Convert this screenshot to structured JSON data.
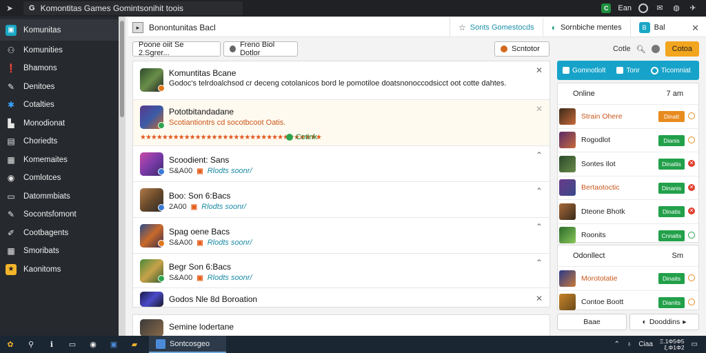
{
  "browser": {
    "url_text": "Komontitas Games Gomintsonihit toois",
    "url_prefix": "G",
    "right_badge": "C",
    "right_label": "Ean"
  },
  "sidebar": {
    "items": [
      {
        "label": "Komunitas",
        "icon": "app-icon",
        "glyph": "▣"
      },
      {
        "label": "Komunities",
        "icon": "users-icon",
        "glyph": "⚇"
      },
      {
        "label": "Bhamons",
        "icon": "info-icon",
        "glyph": "❗"
      },
      {
        "label": "Denitoes",
        "icon": "wrench-icon",
        "glyph": "✎"
      },
      {
        "label": "Cotalties",
        "icon": "tools-icon",
        "glyph": "✱"
      },
      {
        "label": "Monodionat",
        "icon": "chart-icon",
        "glyph": "▙"
      },
      {
        "label": "Choriedts",
        "icon": "chat-icon",
        "glyph": "▤"
      },
      {
        "label": "Komemaites",
        "icon": "grid-icon",
        "glyph": "▦"
      },
      {
        "label": "Comlotces",
        "icon": "circle-icon",
        "glyph": "◉"
      },
      {
        "label": "Datommbiats",
        "icon": "folder-icon",
        "glyph": "▭"
      },
      {
        "label": "Socontsfomont",
        "icon": "tag-icon",
        "glyph": "✎"
      },
      {
        "label": "Cootbagents",
        "icon": "pencil-icon",
        "glyph": "✐"
      },
      {
        "label": "Smoribats",
        "icon": "grid-small-icon",
        "glyph": "▦"
      },
      {
        "label": "Kaonitoms",
        "icon": "star-folder-icon",
        "glyph": "★"
      }
    ]
  },
  "header": {
    "title": "Bonontunitas Bacl",
    "tab_star_label": "Sonts Gomestocds",
    "tab_teal_label": "Sornbiche mentes",
    "tab_box_label": "Bal",
    "tab_box_icon_text": "B"
  },
  "filters": {
    "pill1": "Poone oiit Se 2.Sgrer...",
    "pill2": "Freno Biol Dotlor",
    "pill3": "Scntotor",
    "right_text": "Cotle",
    "orange_btn": "Cotoa"
  },
  "feed": {
    "items": [
      {
        "title": "Komuntitas Bcane",
        "text": "Godoc's telrdoalchsod cr deceng cotolanicos bord le pomotiloe doatsnonoccodsicct oot cotte dahtes."
      },
      {
        "title": "Pototbitandadane",
        "text": "Scotiantiontrs cd socotbcoot Oatis.",
        "stars": "★★★★★★★★★★★★★★★★★★★★★★★★★★★★★★★★★",
        "link": "Cotink"
      },
      {
        "title": "Scoodient: Sans",
        "meta_num": "S&A00",
        "meta_link": "Rlodts soonr/"
      },
      {
        "title": "Boo: Son 6:Bacs",
        "meta_num": "2A00",
        "meta_link": "Rlodts soonr/"
      },
      {
        "title": "Spag oene Bacs",
        "meta_num": "S&A00",
        "meta_link": "Rlodts soonr/"
      },
      {
        "title": "Begr Son 6:Bacs",
        "meta_num": "S&A00",
        "meta_link": "Rlodts soonr/"
      },
      {
        "title": "Godos Nle 8d Boroation"
      }
    ],
    "bottom_title": "Semine lodertane"
  },
  "rpanel": {
    "top": {
      "btn1": "Gomnotlolt",
      "btn2": "Tonr",
      "btn3": "Ticomniat"
    },
    "online": {
      "title": "Online",
      "right": "7 am",
      "rows": [
        {
          "name": "Strain Ohere",
          "btn": "Dinatt",
          "btn_style": "orange",
          "name_style": "orange",
          "x_style": "orange"
        },
        {
          "name": "Rogodlot",
          "btn": "Dianis",
          "btn_style": "green",
          "name_style": "",
          "x_style": "orange"
        },
        {
          "name": "Sontes Ilot",
          "btn": "Dinaitis",
          "btn_style": "green",
          "name_style": "",
          "x_style": "red"
        },
        {
          "name": "Bertaotoctic",
          "btn": "Dinanis",
          "btn_style": "green",
          "name_style": "orange",
          "x_style": "red"
        },
        {
          "name": "Dteone Bhotk",
          "btn": "Dinatis",
          "btn_style": "green",
          "name_style": "",
          "x_style": "red"
        },
        {
          "name": "Roonits",
          "btn": "Cnnalts",
          "btn_style": "green",
          "name_style": "",
          "x_style": "green"
        }
      ]
    },
    "contacts": {
      "title": "Odonllect",
      "right": "Sm",
      "rows": [
        {
          "name": "Morototatie",
          "btn": "Dinaits",
          "btn_style": "green",
          "name_style": "orange",
          "x_style": "orange"
        },
        {
          "name": "Contoe Boott",
          "btn": "Dianits",
          "btn_style": "green",
          "name_style": "",
          "x_style": "orange"
        }
      ]
    },
    "actions": {
      "btn1": "Baae",
      "btn2": "Dooddins"
    }
  },
  "taskbar": {
    "active_label": "Sontcosgeo",
    "tray_text": "Ciaa",
    "clock_line1": "Ξ.1Φ5Φ5",
    "clock_line2": "ξ.Φ1Φ2"
  },
  "colors": {
    "accent_teal": "#17a3c9",
    "orange": "#e88b1f",
    "green": "#22a04a",
    "red": "#e03a2a"
  }
}
